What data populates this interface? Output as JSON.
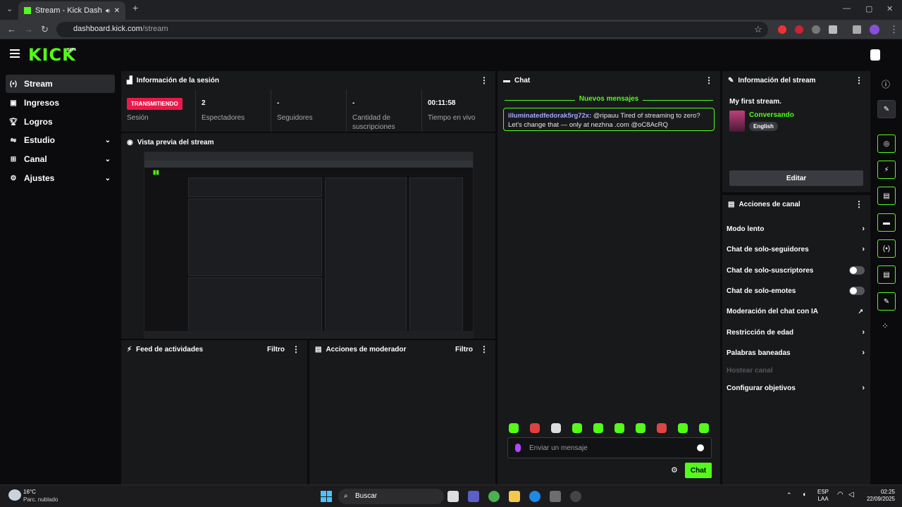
{
  "browser": {
    "tab_title": "Stream - Kick Dashboard",
    "url_host": "dashboard.kick.com",
    "url_path": "/stream"
  },
  "header": {
    "logo": "KICK",
    "beta": "BETA"
  },
  "sidebar": {
    "items": [
      {
        "label": "Stream",
        "icon": "broadcast-icon"
      },
      {
        "label": "Ingresos",
        "icon": "money-icon"
      },
      {
        "label": "Logros",
        "icon": "trophy-icon"
      },
      {
        "label": "Estudio",
        "icon": "studio-icon"
      },
      {
        "label": "Canal",
        "icon": "channel-icon"
      },
      {
        "label": "Ajustes",
        "icon": "gear-icon"
      }
    ]
  },
  "session": {
    "title": "Información de la sesión",
    "badge": "TRANSMITIENDO",
    "badge_label": "Sesión",
    "stats": [
      {
        "value": "2",
        "label": "Espectadores"
      },
      {
        "value": "-",
        "label": "Seguidores"
      },
      {
        "value": "-",
        "label": "Cantidad de suscripciones"
      },
      {
        "value": "00:11:58",
        "label": "Tiempo en vivo"
      }
    ]
  },
  "preview": {
    "title": "Vista previa del stream"
  },
  "activity": {
    "title": "Feed de actividades",
    "filter": "Filtro"
  },
  "moderator": {
    "title": "Acciones de moderador",
    "filter": "Filtro"
  },
  "chat": {
    "title": "Chat",
    "new_messages": "Nuevos mensajes",
    "message_user": "illuminatedfedorak5rg72x:",
    "message_text": " @ripauu Tired of streaming to zero? Let's change that — only at nezhna .com @oC8AcRQ",
    "input_placeholder": "Enviar un mensaje",
    "send_label": "Chat"
  },
  "stream_info": {
    "title": "Información del stream",
    "stream_title": "My first stream.",
    "category": "Conversando",
    "language": "English",
    "edit_label": "Editar"
  },
  "channel_actions": {
    "title": "Acciones de canal",
    "items": [
      {
        "label": "Modo lento",
        "control": "chevron"
      },
      {
        "label": "Chat de solo-seguidores",
        "control": "chevron"
      },
      {
        "label": "Chat de solo-suscriptores",
        "control": "toggle"
      },
      {
        "label": "Chat de solo-emotes",
        "control": "toggle"
      },
      {
        "label": "Moderación del chat con IA",
        "control": "external"
      },
      {
        "label": "Restricción de edad",
        "control": "chevron"
      },
      {
        "label": "Palabras baneadas",
        "control": "chevron"
      },
      {
        "label": "Hostear canal",
        "control": "disabled"
      },
      {
        "label": "Configurar objetivos",
        "control": "chevron"
      }
    ]
  },
  "taskbar": {
    "temperature": "16°C",
    "weather": "Parc. nublado",
    "search": "Buscar",
    "lang_top": "ESP",
    "lang_bottom": "LAA",
    "time": "02:25",
    "date": "22/09/2025"
  },
  "colors": {
    "accent": "#53fc18",
    "live": "#e91a4a",
    "panel": "#18191b"
  }
}
